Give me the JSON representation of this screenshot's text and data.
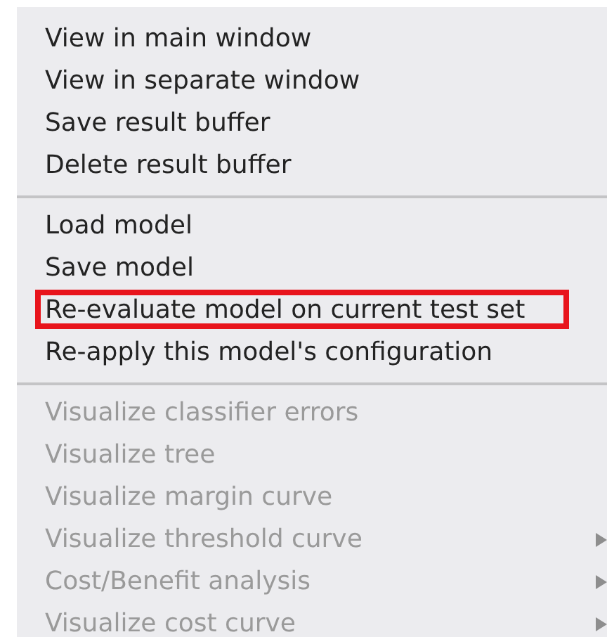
{
  "menu": {
    "groups": [
      {
        "items": [
          {
            "label": "View in main window",
            "disabled": false,
            "submenu": false,
            "highlighted": false
          },
          {
            "label": "View in separate window",
            "disabled": false,
            "submenu": false,
            "highlighted": false
          },
          {
            "label": "Save result buffer",
            "disabled": false,
            "submenu": false,
            "highlighted": false
          },
          {
            "label": "Delete result buffer",
            "disabled": false,
            "submenu": false,
            "highlighted": false
          }
        ]
      },
      {
        "items": [
          {
            "label": "Load model",
            "disabled": false,
            "submenu": false,
            "highlighted": false
          },
          {
            "label": "Save model",
            "disabled": false,
            "submenu": false,
            "highlighted": false
          },
          {
            "label": "Re-evaluate model on current test set",
            "disabled": false,
            "submenu": false,
            "highlighted": true
          },
          {
            "label": "Re-apply this model's configuration",
            "disabled": false,
            "submenu": false,
            "highlighted": false
          }
        ]
      },
      {
        "items": [
          {
            "label": "Visualize classifier errors",
            "disabled": true,
            "submenu": false,
            "highlighted": false
          },
          {
            "label": "Visualize tree",
            "disabled": true,
            "submenu": false,
            "highlighted": false
          },
          {
            "label": "Visualize margin curve",
            "disabled": true,
            "submenu": false,
            "highlighted": false
          },
          {
            "label": "Visualize threshold curve",
            "disabled": true,
            "submenu": true,
            "highlighted": false
          },
          {
            "label": "Cost/Benefit analysis",
            "disabled": true,
            "submenu": true,
            "highlighted": false
          },
          {
            "label": "Visualize cost curve",
            "disabled": true,
            "submenu": true,
            "highlighted": false
          }
        ]
      }
    ]
  }
}
